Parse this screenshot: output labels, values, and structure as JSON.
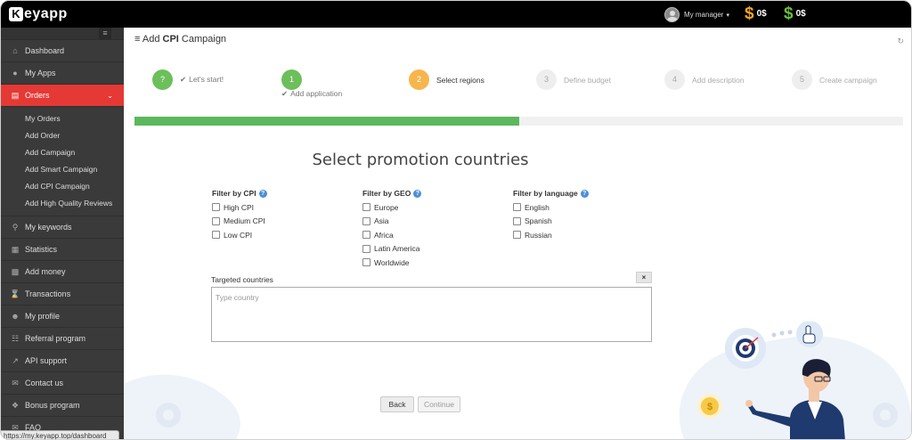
{
  "app": {
    "logo_letter": "K",
    "logo_text": "eyapp"
  },
  "topbar": {
    "manager_label": "My manager",
    "balances": [
      {
        "symbol": "$",
        "amount": "0$",
        "color": "#f5a623"
      },
      {
        "symbol": "$",
        "amount": "0$",
        "color": "#6cbf3a"
      }
    ]
  },
  "sidebar": {
    "items": [
      {
        "label": "Dashboard",
        "icon": "home-icon"
      },
      {
        "label": "My Apps",
        "icon": "circle-icon"
      },
      {
        "label": "Orders",
        "icon": "list-icon",
        "active": true
      },
      {
        "label": "My keywords",
        "icon": "key-icon"
      },
      {
        "label": "Statistics",
        "icon": "table-icon"
      },
      {
        "label": "Add money",
        "icon": "money-icon"
      },
      {
        "label": "Transactions",
        "icon": "spinner-icon"
      },
      {
        "label": "My profile",
        "icon": "user-icon"
      },
      {
        "label": "Referral program",
        "icon": "sitemap-icon"
      },
      {
        "label": "API support",
        "icon": "external-link-icon"
      },
      {
        "label": "Contact us",
        "icon": "envelope-icon"
      },
      {
        "label": "Bonus program",
        "icon": "gift-icon"
      },
      {
        "label": "FAQ",
        "icon": "comments-icon"
      }
    ],
    "orders_sub": [
      "My Orders",
      "Add Order",
      "Add Campaign",
      "Add Smart Campaign",
      "Add CPI Campaign",
      "Add High Quality Reviews"
    ]
  },
  "status_url": "https://my.keyapp.top/dashboard",
  "page": {
    "title_prefix": "Add ",
    "title_bold": "CPI",
    "title_suffix": " Campaign"
  },
  "steps": [
    {
      "num": "?",
      "label": "Let's start!",
      "state": "done"
    },
    {
      "num": "1",
      "label": "Add application",
      "state": "done"
    },
    {
      "num": "2",
      "label": "Select regions",
      "state": "current"
    },
    {
      "num": "3",
      "label": "Define budget",
      "state": "todo"
    },
    {
      "num": "4",
      "label": "Add description",
      "state": "todo"
    },
    {
      "num": "5",
      "label": "Create campaign",
      "state": "todo"
    }
  ],
  "progress": {
    "fraction": 0.5,
    "color": "#5cb85c"
  },
  "section_title": "Select promotion countries",
  "filters": {
    "cpi": {
      "title": "Filter by CPI",
      "options": [
        "High CPI",
        "Medium CPI",
        "Low CPI"
      ]
    },
    "geo": {
      "title": "Filter by GEO",
      "options": [
        "Europe",
        "Asia",
        "Africa",
        "Latin America",
        "Worldwide"
      ]
    },
    "language": {
      "title": "Filter by language",
      "options": [
        "English",
        "Spanish",
        "Russian"
      ]
    }
  },
  "targeted": {
    "label": "Targeted countries",
    "placeholder": "Type country",
    "clear_label": "×"
  },
  "buttons": {
    "back": "Back",
    "continue": "Continue"
  },
  "colors": {
    "accent_red": "#e53935",
    "step_done": "#6cbf5a",
    "step_current": "#f6b64d"
  }
}
